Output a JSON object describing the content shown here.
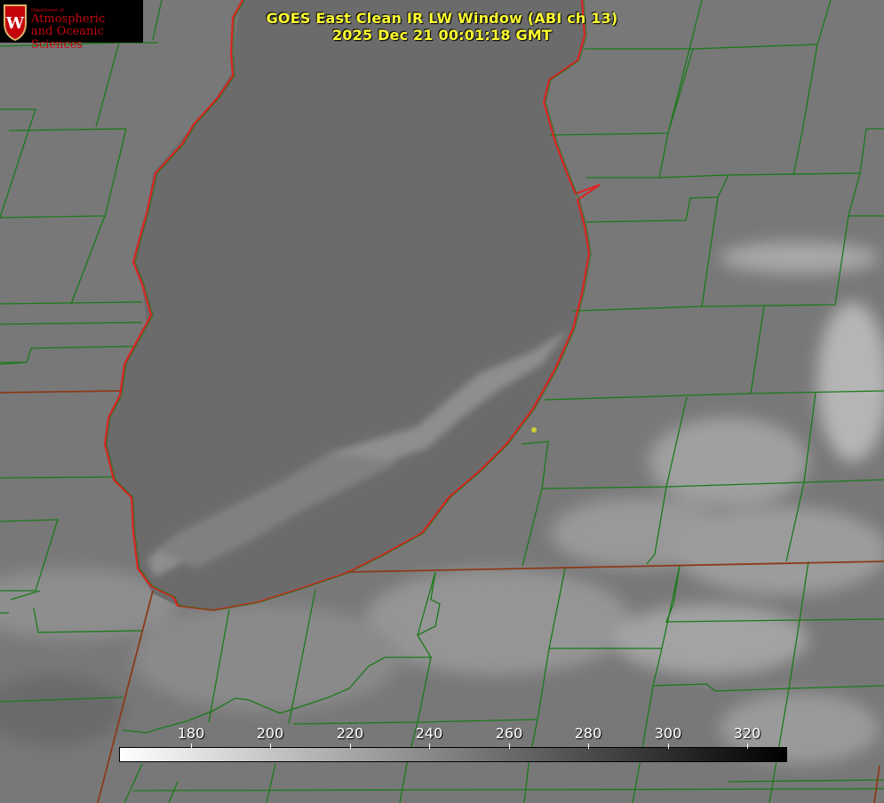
{
  "header": {
    "title": "GOES East Clean IR LW Window (ABI ch 13)",
    "timestamp": "2025 Dec 21 00:01:18 GMT"
  },
  "logo": {
    "department_label": "Department of",
    "line1": "Atmospheric",
    "line2": "and Oceanic Sciences",
    "crest_letter": "W"
  },
  "colorbar": {
    "ticks": [
      "180",
      "200",
      "220",
      "240",
      "260",
      "280",
      "300",
      "320"
    ],
    "gradient_from": "#ffffff",
    "gradient_to": "#000000"
  },
  "map": {
    "county_line_color": "#1a7a1a",
    "state_line_color": "#8b3a1a",
    "lake_outline_color": "#e02020",
    "marker_color": "#cccc33"
  }
}
